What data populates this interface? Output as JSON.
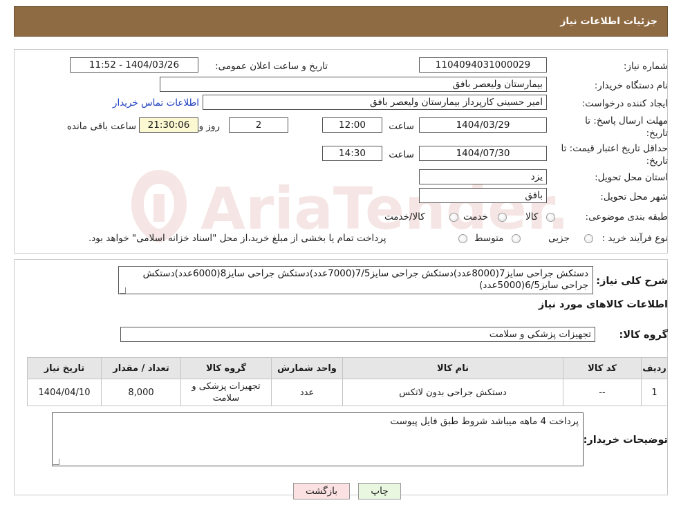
{
  "header": {
    "title": "جزئیات اطلاعات نیاز"
  },
  "watermark": {
    "text": "AriaTender.neT"
  },
  "form": {
    "need_number_label": "شماره نیاز:",
    "need_number": "1104094031000029",
    "announce_label": "تاریخ و ساعت اعلان عمومی:",
    "announce_value": "1404/03/26 - 11:52",
    "buyer_org_label": "نام دستگاه خریدار:",
    "buyer_org": "بیمارستان ولیعصر بافق",
    "creator_label": "ایجاد کننده درخواست:",
    "creator": "امیر حسینی کارپرداز بیمارستان ولیعصر بافق",
    "contact_link": "اطلاعات تماس خریدار",
    "deadline_label": "مهلت ارسال پاسخ: تا تاریخ:",
    "deadline_date": "1404/03/29",
    "time_label": "ساعت",
    "deadline_time": "12:00",
    "days_value": "2",
    "days_label": "روز و",
    "remaining_time": "21:30:06",
    "remaining_label": "ساعت باقی مانده",
    "validity_label": "حداقل تاریخ اعتبار قیمت: تا تاریخ:",
    "validity_date": "1404/07/30",
    "validity_time": "14:30",
    "province_label": "استان محل تحویل:",
    "province": "یزد",
    "city_label": "شهر محل تحویل:",
    "city": "بافق",
    "category_label": "طبقه بندی موضوعی:",
    "category_options": [
      "کالا",
      "خدمت",
      "کالا/خدمت"
    ],
    "process_label": "نوع فرآیند خرید :",
    "process_options": [
      "جزیی",
      "متوسط"
    ],
    "process_note": "پرداخت تمام یا بخشی از مبلغ خرید،از محل \"اسناد خزانه اسلامی\" خواهد بود."
  },
  "description": {
    "label": "شرح کلی نیاز:",
    "text": "دستکش جراحی سایز7(8000عدد)دستکش جراحی سایز7/5(7000عدد)دستکش جراحی سایز8(6000عدد)دستکش جراحی سایز6/5(5000عدد)"
  },
  "goods": {
    "section_title": "اطلاعات کالاهای مورد نیاز",
    "group_label": "گروه کالا:",
    "group_value": "تجهیزات پزشکی و سلامت",
    "columns": [
      "ردیف",
      "کد کالا",
      "نام کالا",
      "واحد شمارش",
      "گروه کالا",
      "تعداد / مقدار",
      "تاریخ نیاز"
    ],
    "rows": [
      [
        "1",
        "--",
        "دستکش جراحی بدون لاتکس",
        "عدد",
        "تجهیزات پزشکی و سلامت",
        "8,000",
        "1404/04/10"
      ]
    ]
  },
  "buyer_notes": {
    "label": "توضیحات خریدار:",
    "text": "پرداخت 4 ماهه میباشد شروط طبق فایل پیوست"
  },
  "buttons": {
    "print": "چاپ",
    "back": "بازگشت"
  },
  "colors": {
    "header": "#8f6b43",
    "link": "#1d3fc1",
    "remaining_bg": "#fbf8d2",
    "print_bg": "#e9f7e1",
    "back_bg": "#fbe1e1"
  }
}
